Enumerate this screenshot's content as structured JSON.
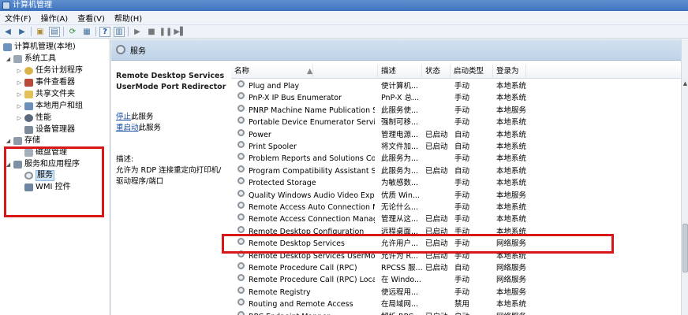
{
  "window": {
    "title": "计算机管理"
  },
  "menu": [
    "文件(F)",
    "操作(A)",
    "查看(V)",
    "帮助(H)"
  ],
  "tree": {
    "root": "计算机管理(本地)",
    "items": [
      {
        "label": "系统工具",
        "depth": 0,
        "expander": "◢"
      },
      {
        "label": "任务计划程序",
        "depth": 1,
        "expander": "▷"
      },
      {
        "label": "事件查看器",
        "depth": 1,
        "expander": "▷"
      },
      {
        "label": "共享文件夹",
        "depth": 1,
        "expander": "▷"
      },
      {
        "label": "本地用户和组",
        "depth": 1,
        "expander": "▷"
      },
      {
        "label": "性能",
        "depth": 1,
        "expander": "▷"
      },
      {
        "label": "设备管理器",
        "depth": 1,
        "expander": ""
      },
      {
        "label": "存储",
        "depth": 0,
        "expander": "◢"
      },
      {
        "label": "磁盘管理",
        "depth": 1,
        "expander": ""
      },
      {
        "label": "服务和应用程序",
        "depth": 0,
        "expander": "◢"
      },
      {
        "label": "服务",
        "depth": 1,
        "expander": ""
      },
      {
        "label": "WMI 控件",
        "depth": 1,
        "expander": ""
      }
    ]
  },
  "panel": {
    "title": "服务"
  },
  "details": {
    "service_name": "Remote Desktop Services UserMode Port Redirector",
    "stop_link": "停止",
    "stop_suffix": "此服务",
    "restart_link": "重启动",
    "restart_suffix": "此服务",
    "desc_label": "描述:",
    "desc_text": "允许为 RDP 连接重定向打印机/驱动程序/端口"
  },
  "columns": [
    "名称",
    "描述",
    "状态",
    "启动类型",
    "登录为"
  ],
  "services": [
    {
      "name": "Plug and Play",
      "desc": "使计算机...",
      "status": "",
      "startup": "手动",
      "logon": "本地系统"
    },
    {
      "name": "PnP-X IP Bus Enumerator",
      "desc": "PnP-X 总...",
      "status": "",
      "startup": "手动",
      "logon": "本地系统"
    },
    {
      "name": "PNRP Machine Name Publication Se...",
      "desc": "此服务使...",
      "status": "",
      "startup": "手动",
      "logon": "本地服务"
    },
    {
      "name": "Portable Device Enumerator Service",
      "desc": "强制可移...",
      "status": "",
      "startup": "手动",
      "logon": "本地系统"
    },
    {
      "name": "Power",
      "desc": "管理电源...",
      "status": "已启动",
      "startup": "自动",
      "logon": "本地系统"
    },
    {
      "name": "Print Spooler",
      "desc": "将文件加...",
      "status": "已启动",
      "startup": "自动",
      "logon": "本地系统"
    },
    {
      "name": "Problem Reports and Solutions Con...",
      "desc": "此服务为...",
      "status": "",
      "startup": "手动",
      "logon": "本地系统"
    },
    {
      "name": "Program Compatibility Assistant Ser...",
      "desc": "此服务为...",
      "status": "已启动",
      "startup": "自动",
      "logon": "本地系统"
    },
    {
      "name": "Protected Storage",
      "desc": "为敏感数...",
      "status": "",
      "startup": "手动",
      "logon": "本地系统"
    },
    {
      "name": "Quality Windows Audio Video Exper...",
      "desc": "优质 Win...",
      "status": "",
      "startup": "手动",
      "logon": "本地服务"
    },
    {
      "name": "Remote Access Auto Connection Ma...",
      "desc": "无论什么...",
      "status": "",
      "startup": "手动",
      "logon": "本地系统"
    },
    {
      "name": "Remote Access Connection Manager",
      "desc": "管理从这...",
      "status": "已启动",
      "startup": "手动",
      "logon": "本地系统"
    },
    {
      "name": "Remote Desktop Configuration",
      "desc": "远程桌面...",
      "status": "已启动",
      "startup": "手动",
      "logon": "本地系统"
    },
    {
      "name": "Remote Desktop Services",
      "desc": "允许用户...",
      "status": "已启动",
      "startup": "手动",
      "logon": "网络服务"
    },
    {
      "name": "Remote Desktop Services UserMod...",
      "desc": "允许为 R...",
      "status": "已启动",
      "startup": "手动",
      "logon": "本地系统"
    },
    {
      "name": "Remote Procedure Call (RPC)",
      "desc": "RPCSS 服...",
      "status": "已启动",
      "startup": "自动",
      "logon": "网络服务"
    },
    {
      "name": "Remote Procedure Call (RPC) Locator",
      "desc": "在 Windo...",
      "status": "",
      "startup": "手动",
      "logon": "网络服务"
    },
    {
      "name": "Remote Registry",
      "desc": "使远程用...",
      "status": "",
      "startup": "手动",
      "logon": "本地服务"
    },
    {
      "name": "Routing and Remote Access",
      "desc": "在局域网...",
      "status": "",
      "startup": "禁用",
      "logon": "本地系统"
    },
    {
      "name": "RPC Endpoint Mapper",
      "desc": "解析 RPC...",
      "status": "已启动",
      "startup": "自动",
      "logon": "网络服务"
    }
  ],
  "icons": {
    "toolbar": [
      "back-icon",
      "forward-icon",
      "up-folder-icon",
      "show-tree-icon",
      "refresh-icon",
      "export-icon",
      "help-icon",
      "properties-icon",
      "play-icon",
      "stop-icon",
      "pause-icon",
      "restart-icon"
    ],
    "service": "gear-icon"
  },
  "colors": {
    "highlight": "#d81818",
    "selection": "#cde3f7",
    "link": "#1a4fa3"
  }
}
